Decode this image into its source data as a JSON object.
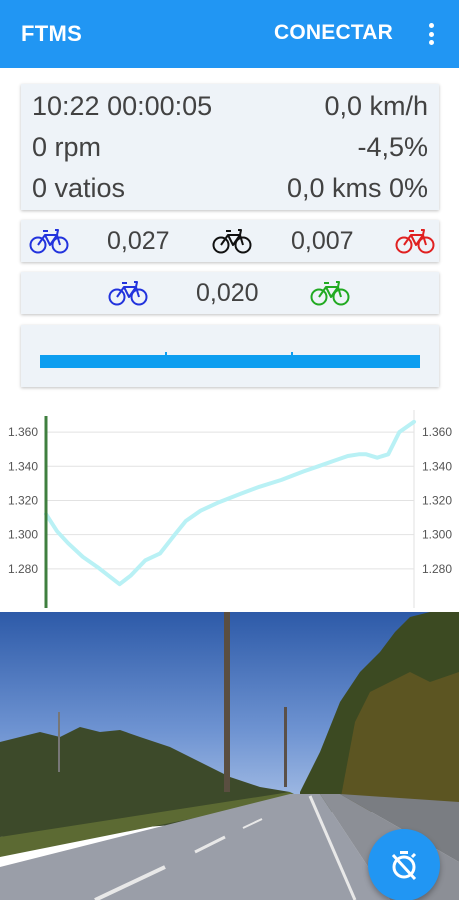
{
  "appbar": {
    "title": "FTMS",
    "connect_label": "CONECTAR",
    "menu_icon": "more-vert-icon"
  },
  "stats": {
    "time": "10:22 00:00:05",
    "speed": "0,0 km/h",
    "cadence": "0 rpm",
    "slope": "-4,5%",
    "power": "0 vatios",
    "distance": "0,0 kms 0%"
  },
  "differences": {
    "row1": [
      {
        "value": "0,027",
        "icon": "bike-icon",
        "color": "#2233dd"
      },
      {
        "value": "0,007",
        "icon": "bike-icon",
        "color": "#111111"
      },
      {
        "icon": "bike-icon",
        "color": "#e02020"
      }
    ],
    "row2": [
      {
        "value": "0,020",
        "icon": "bike-icon",
        "color": "#2233dd"
      },
      {
        "icon": "bike-icon",
        "color": "#22aa22"
      }
    ]
  },
  "progress": {
    "value_fraction": 1.0,
    "color": "#0d9ef0"
  },
  "chart_data": {
    "type": "line",
    "title": "",
    "xlabel": "",
    "ylabel": "",
    "ylim": [
      1.26,
      1.37
    ],
    "y_ticks": [
      1.28,
      1.3,
      1.32,
      1.34,
      1.36
    ],
    "y_tick_labels": [
      "1.280",
      "1.300",
      "1.320",
      "1.340",
      "1.360"
    ],
    "grid": true,
    "current_position_marker_x": 0.0,
    "series": [
      {
        "color": "#b9f1f5",
        "x": [
          0,
          0.03,
          0.06,
          0.1,
          0.14,
          0.17,
          0.2,
          0.23,
          0.27,
          0.31,
          0.35,
          0.38,
          0.42,
          0.47,
          0.53,
          0.58,
          0.64,
          0.7,
          0.74,
          0.78,
          0.82,
          0.85,
          0.87,
          0.9,
          0.93,
          0.96,
          1.0
        ],
        "values": [
          1.312,
          1.302,
          1.295,
          1.287,
          1.281,
          1.276,
          1.271,
          1.276,
          1.285,
          1.289,
          1.3,
          1.308,
          1.314,
          1.319,
          1.324,
          1.328,
          1.332,
          1.337,
          1.34,
          1.343,
          1.346,
          1.347,
          1.347,
          1.345,
          1.347,
          1.36,
          1.366
        ]
      }
    ]
  },
  "photo": {
    "alt": "road-scene-image"
  },
  "fab": {
    "icon": "timer-off-icon"
  }
}
